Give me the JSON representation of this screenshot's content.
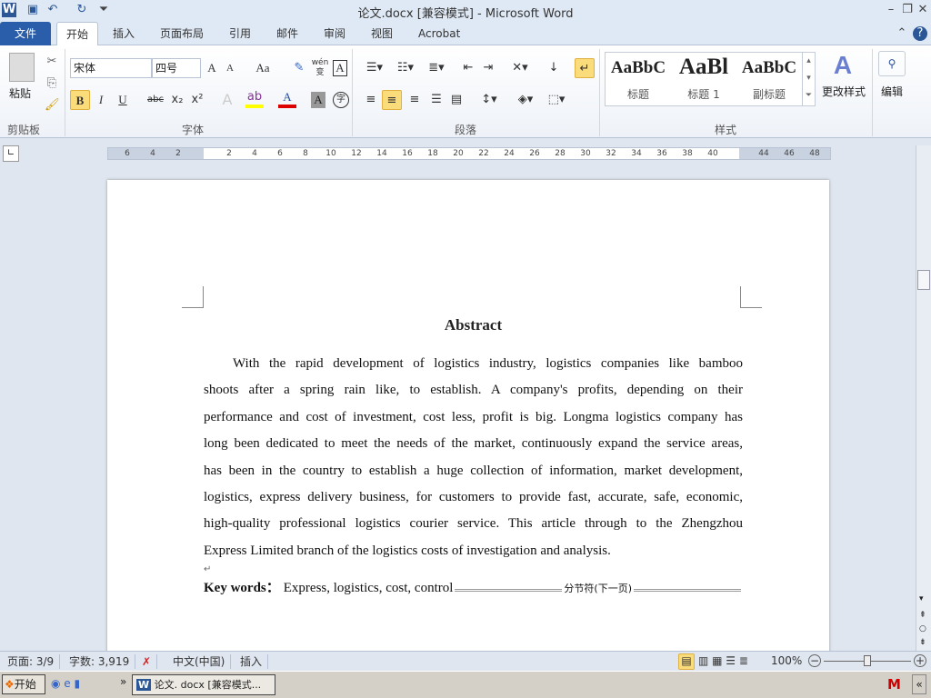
{
  "window": {
    "title": "论文.docx [兼容模式]  -  Microsoft Word"
  },
  "quick_access": {
    "word_icon": "W",
    "save": "save-icon",
    "undo": "undo-icon",
    "redo": "redo-icon"
  },
  "tabs": [
    {
      "label": "文件"
    },
    {
      "label": "开始"
    },
    {
      "label": "插入"
    },
    {
      "label": "页面布局"
    },
    {
      "label": "引用"
    },
    {
      "label": "邮件"
    },
    {
      "label": "审阅"
    },
    {
      "label": "视图"
    },
    {
      "label": "Acrobat"
    }
  ],
  "ribbon": {
    "clipboard": {
      "paste": "粘贴",
      "label": "剪贴板"
    },
    "font": {
      "name": "宋体",
      "size": "四号",
      "label": "字体",
      "grow": "A",
      "shrink": "A",
      "case": "Aa",
      "bold": "B",
      "italic": "I",
      "underline": "U",
      "strike": "abc",
      "sub": "x₂",
      "sup": "x²",
      "color": "A",
      "shade": "A",
      "wen": "wén 变",
      "border": "A",
      "circle": "字"
    },
    "paragraph": {
      "label": "段落"
    },
    "styles": {
      "label": "样式",
      "items": [
        {
          "preview": "AaBbC",
          "name": "标题"
        },
        {
          "preview": "AaBl",
          "name": "标题 1"
        },
        {
          "preview": "AaBbC",
          "name": "副标题"
        }
      ],
      "change": "更改样式"
    },
    "editing": {
      "label": "编辑"
    }
  },
  "ruler": {
    "left": [
      "6",
      "4",
      "2"
    ],
    "right": [
      "2",
      "4",
      "6",
      "8",
      "10",
      "12",
      "14",
      "16",
      "18",
      "20",
      "22",
      "24",
      "26",
      "28",
      "30",
      "32",
      "34",
      "36",
      "38",
      "40",
      "44",
      "46",
      "48"
    ]
  },
  "document": {
    "heading": "Abstract",
    "lines": [
      "With the rapid development of logistics industry, logistics companies like bamboo",
      "shoots after a spring rain like, to establish. A company's profits, depending on their",
      "performance and cost of investment, cost less, profit is big. Longma logistics company has",
      "long been dedicated to meet the needs of the market, continuously expand the service areas,",
      "has been in the country to establish a huge collection of information, market development,",
      "logistics, express delivery business, for customers to provide fast, accurate, safe, economic,",
      "high-quality professional logistics courier service. This article through to the Zhengzhou",
      "Express Limited branch of the logistics costs of investigation and analysis."
    ],
    "keywords_label": "Key words：",
    "keywords": "Express, logistics, cost, control",
    "section_break": "分节符(下一页)"
  },
  "status": {
    "page": "页面: 3/9",
    "words": "字数: 3,919",
    "language": "中文(中国)",
    "mode": "插入",
    "zoom": "100%",
    "zoom_level": 100
  },
  "taskbar": {
    "start": "开始",
    "task": "论文. docx [兼容模式..."
  }
}
